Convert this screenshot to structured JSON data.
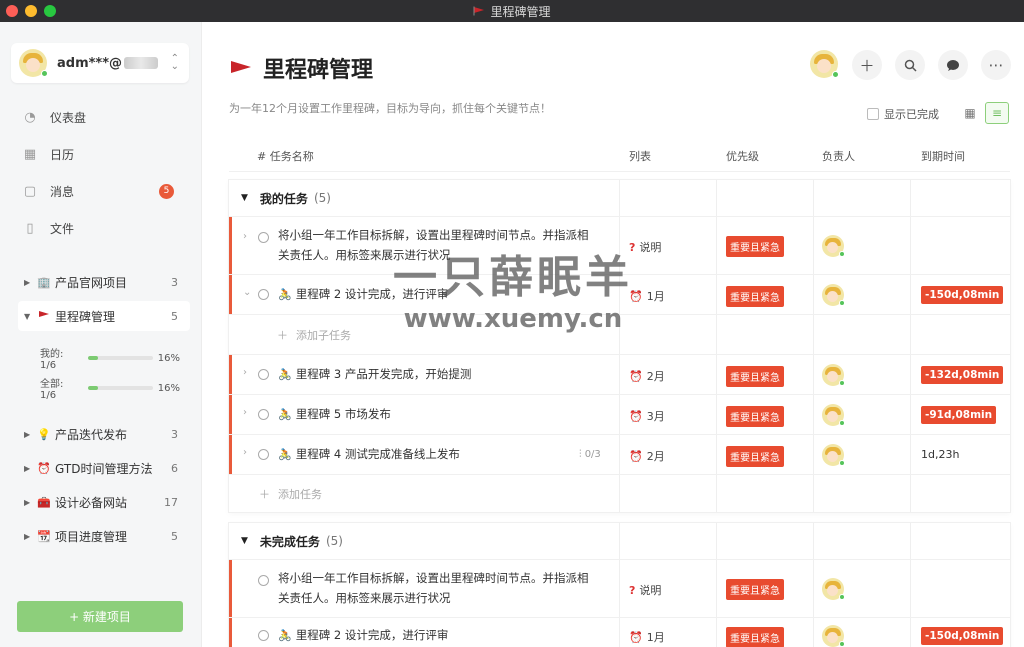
{
  "window": {
    "title": "里程碑管理"
  },
  "colors": {
    "accent": "#8dcf7b",
    "danger": "#e84b2f",
    "flag": "#c8252a"
  },
  "sidebar": {
    "user": {
      "name": "adm***@"
    },
    "nav": [
      {
        "label": "仪表盘",
        "icon": "dashboard-icon"
      },
      {
        "label": "日历",
        "icon": "calendar-icon"
      },
      {
        "label": "消息",
        "icon": "message-icon",
        "badge": "5"
      },
      {
        "label": "文件",
        "icon": "file-icon"
      }
    ],
    "projects": [
      {
        "label": "产品官网项目",
        "count": "3",
        "icon": "building-icon"
      },
      {
        "label": "里程碑管理",
        "count": "5",
        "icon": "flag-icon"
      },
      {
        "label": "产品迭代发布",
        "count": "3",
        "icon": "bulb-icon"
      },
      {
        "label": "GTD时间管理方法",
        "count": "6",
        "icon": "alarm-icon"
      },
      {
        "label": "设计必备网站",
        "count": "17",
        "icon": "toolbox-icon"
      },
      {
        "label": "项目进度管理",
        "count": "5",
        "icon": "calendar-icon"
      }
    ],
    "progress": [
      {
        "label": "我的: 1/6",
        "pct": "16%",
        "value": 0.16
      },
      {
        "label": "全部: 1/6",
        "pct": "16%",
        "value": 0.16
      }
    ],
    "new_project": "+ 新建项目"
  },
  "main": {
    "title": "里程碑管理",
    "subtitle": "为一年12个月设置工作里程碑，目标为导向，抓住每个关键节点！",
    "show_done": "显示已完成",
    "columns": [
      "# 任务名称",
      "列表",
      "优先级",
      "负责人",
      "到期时间"
    ],
    "groups": [
      {
        "title": "我的任务",
        "count": "(5)",
        "tasks": [
          {
            "name": "将小组一年工作目标拆解，设置出里程碑时间节点。并指派相关责任人。用标签来展示进行状况",
            "list": "说明",
            "list_icon": "question-icon",
            "priority": "重要且紧急",
            "due": "",
            "overdue": false,
            "emoji": ""
          },
          {
            "name": "里程碑 2 设计完成，进行评审",
            "list": "1月",
            "list_icon": "alarm-icon",
            "priority": "重要且紧急",
            "due": "-150d,08min",
            "overdue": true,
            "emoji": "🚴"
          },
          {
            "name": "里程碑 3 产品开发完成，开始提测",
            "list": "2月",
            "list_icon": "alarm-icon",
            "priority": "重要且紧急",
            "due": "-132d,08min",
            "overdue": true,
            "emoji": "🚴"
          },
          {
            "name": "里程碑 5 市场发布",
            "list": "3月",
            "list_icon": "alarm-icon",
            "priority": "重要且紧急",
            "due": "-91d,08min",
            "overdue": true,
            "emoji": "🚴"
          },
          {
            "name": "里程碑 4 测试完成准备线上发布",
            "list": "2月",
            "list_icon": "alarm-icon",
            "priority": "重要且紧急",
            "due": "1d,23h",
            "overdue": false,
            "emoji": "🚴",
            "subtasks": "0/3"
          }
        ],
        "add_subtask": "添加子任务",
        "add_task": "添加任务"
      },
      {
        "title": "未完成任务",
        "count": "(5)",
        "tasks": [
          {
            "name": "将小组一年工作目标拆解，设置出里程碑时间节点。并指派相关责任人。用标签来展示进行状况",
            "list": "说明",
            "priority": "重要且紧急",
            "due": "",
            "overdue": false
          },
          {
            "name": "里程碑 2 设计完成，进行评审",
            "list": "1月",
            "priority": "重要且紧急",
            "due": "-150d,08min",
            "overdue": true,
            "emoji": "🚴"
          }
        ]
      }
    ]
  },
  "watermark": {
    "line1": "一只薛眠羊",
    "line2": "www.xuemy.cn"
  }
}
